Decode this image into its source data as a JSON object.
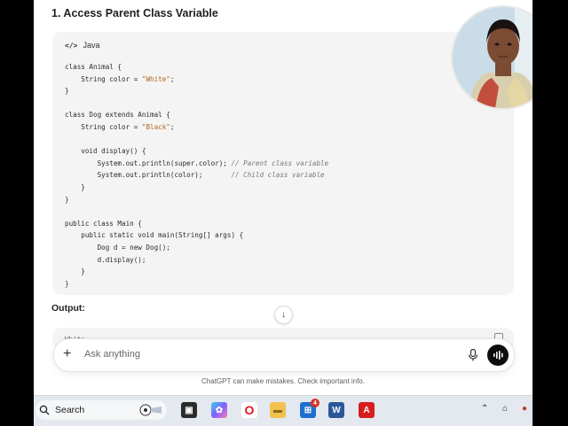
{
  "heading": "1. Access Parent Class Variable",
  "code_block": {
    "language": "Java",
    "lines": [
      [
        {
          "t": "class Animal {",
          "c": "kw-mixed"
        }
      ],
      [
        {
          "t": "    String color = ",
          "c": ""
        },
        {
          "t": "\"White\"",
          "c": "str"
        },
        {
          "t": ";",
          "c": ""
        }
      ],
      [
        {
          "t": "}",
          "c": ""
        }
      ],
      [
        {
          "t": "",
          "c": ""
        }
      ],
      [
        {
          "t": "class Dog extends Animal {",
          "c": ""
        }
      ],
      [
        {
          "t": "    String color = ",
          "c": ""
        },
        {
          "t": "\"Black\"",
          "c": "str"
        },
        {
          "t": ";",
          "c": ""
        }
      ],
      [
        {
          "t": "",
          "c": ""
        }
      ],
      [
        {
          "t": "    void display() {",
          "c": ""
        }
      ],
      [
        {
          "t": "        System.out.println(super.color); ",
          "c": ""
        },
        {
          "t": "// Parent class variable",
          "c": "cmt"
        }
      ],
      [
        {
          "t": "        System.out.println(color);       ",
          "c": ""
        },
        {
          "t": "// Child class variable",
          "c": "cmt"
        }
      ],
      [
        {
          "t": "    }",
          "c": ""
        }
      ],
      [
        {
          "t": "}",
          "c": ""
        }
      ],
      [
        {
          "t": "",
          "c": ""
        }
      ],
      [
        {
          "t": "public class Main {",
          "c": ""
        }
      ],
      [
        {
          "t": "    public static void main(String[] args) {",
          "c": ""
        }
      ],
      [
        {
          "t": "        Dog d = new Dog();",
          "c": ""
        }
      ],
      [
        {
          "t": "        d.display();",
          "c": ""
        }
      ],
      [
        {
          "t": "    }",
          "c": ""
        }
      ],
      [
        {
          "t": "}",
          "c": ""
        }
      ]
    ]
  },
  "output_label": "Output:",
  "output_peek": "White",
  "composer": {
    "placeholder": "Ask anything"
  },
  "disclaimer": "ChatGPT can make mistakes. Check important info.",
  "taskbar": {
    "search_label": "Search",
    "notification_count": "4"
  },
  "colors": {
    "code_bg": "#f4f4f4",
    "keyword": "#a0522d",
    "string": "#b5651d",
    "comment": "#777777",
    "voice_button": "#0d0d0d"
  }
}
